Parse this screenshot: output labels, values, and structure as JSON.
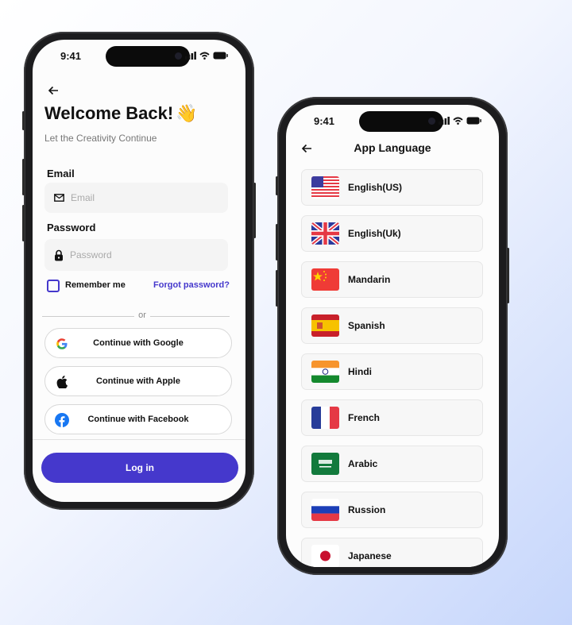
{
  "status_bar": {
    "time": "9:41"
  },
  "login": {
    "title": "Welcome Back!",
    "title_emoji": "👋",
    "subtitle": "Let the Creativity Continue",
    "email_label": "Email",
    "email_placeholder": "Email",
    "password_label": "Password",
    "password_placeholder": "Password",
    "remember_label": "Remember me",
    "remember_checked": false,
    "forgot_label": "Forgot password?",
    "divider_text": "or",
    "social": [
      {
        "label": "Continue with Google",
        "icon": "google-icon"
      },
      {
        "label": "Continue with Apple",
        "icon": "apple-icon"
      },
      {
        "label": "Continue with Facebook",
        "icon": "facebook-icon"
      }
    ],
    "login_label": "Log in",
    "accent": "#4538cc"
  },
  "language": {
    "title": "App Language",
    "items": [
      {
        "label": "English(US)",
        "flag": "us"
      },
      {
        "label": "English(Uk)",
        "flag": "uk"
      },
      {
        "label": "Mandarin",
        "flag": "cn"
      },
      {
        "label": "Spanish",
        "flag": "es"
      },
      {
        "label": "Hindi",
        "flag": "in"
      },
      {
        "label": "French",
        "flag": "fr"
      },
      {
        "label": "Arabic",
        "flag": "sa"
      },
      {
        "label": "Russion",
        "flag": "ru"
      },
      {
        "label": "Japanese",
        "flag": "jp"
      }
    ]
  }
}
